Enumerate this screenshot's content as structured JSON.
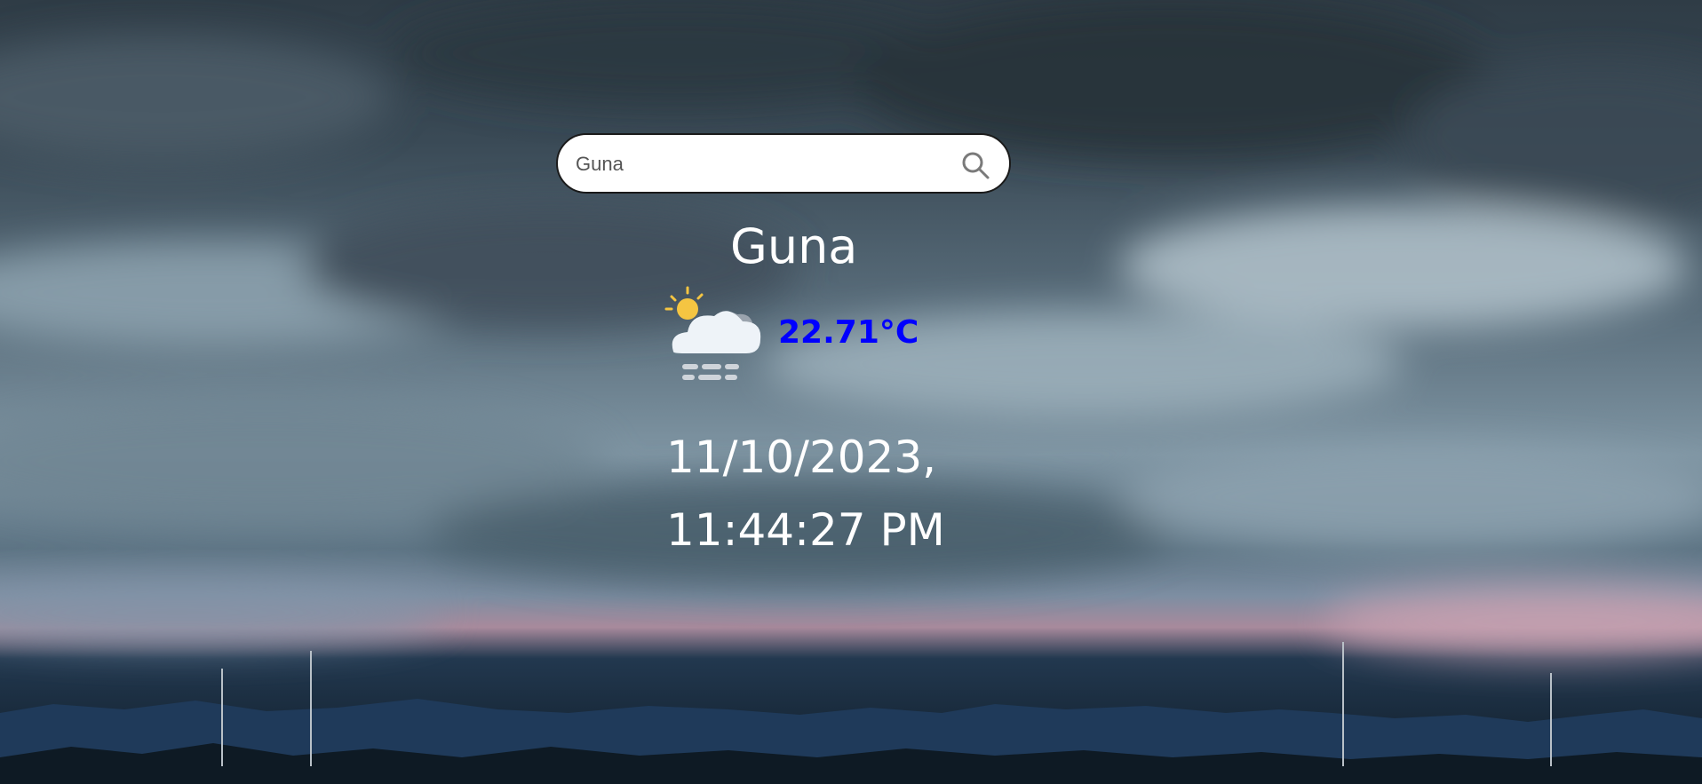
{
  "search": {
    "value": "Guna",
    "icon": "search-icon"
  },
  "weather": {
    "city": "Guna",
    "temperature": "22.71°C",
    "condition_icon": "cloud-sun-fog-icon",
    "temperature_color": "#0000ff"
  },
  "datetime": {
    "text": "11/10/2023, 11:44:27 PM"
  },
  "background": {
    "theme": "stormy-clouds"
  }
}
